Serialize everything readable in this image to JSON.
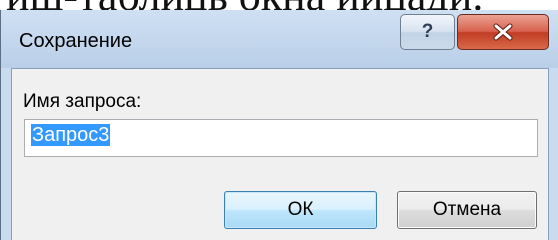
{
  "background_text": "иш-таблиць окна иицади.",
  "dialog": {
    "title": "Сохранение",
    "help_label": "?",
    "close_icon": "close-icon"
  },
  "form": {
    "label": "Имя запроса:",
    "value": "Запрос3",
    "value_selected": true
  },
  "buttons": {
    "ok": "ОК",
    "cancel": "Отмена"
  },
  "colors": {
    "title_bar": "#c9dbee",
    "close_button": "#c7432b",
    "selection": "#3399ff",
    "ok_border": "#3c7fb1"
  }
}
